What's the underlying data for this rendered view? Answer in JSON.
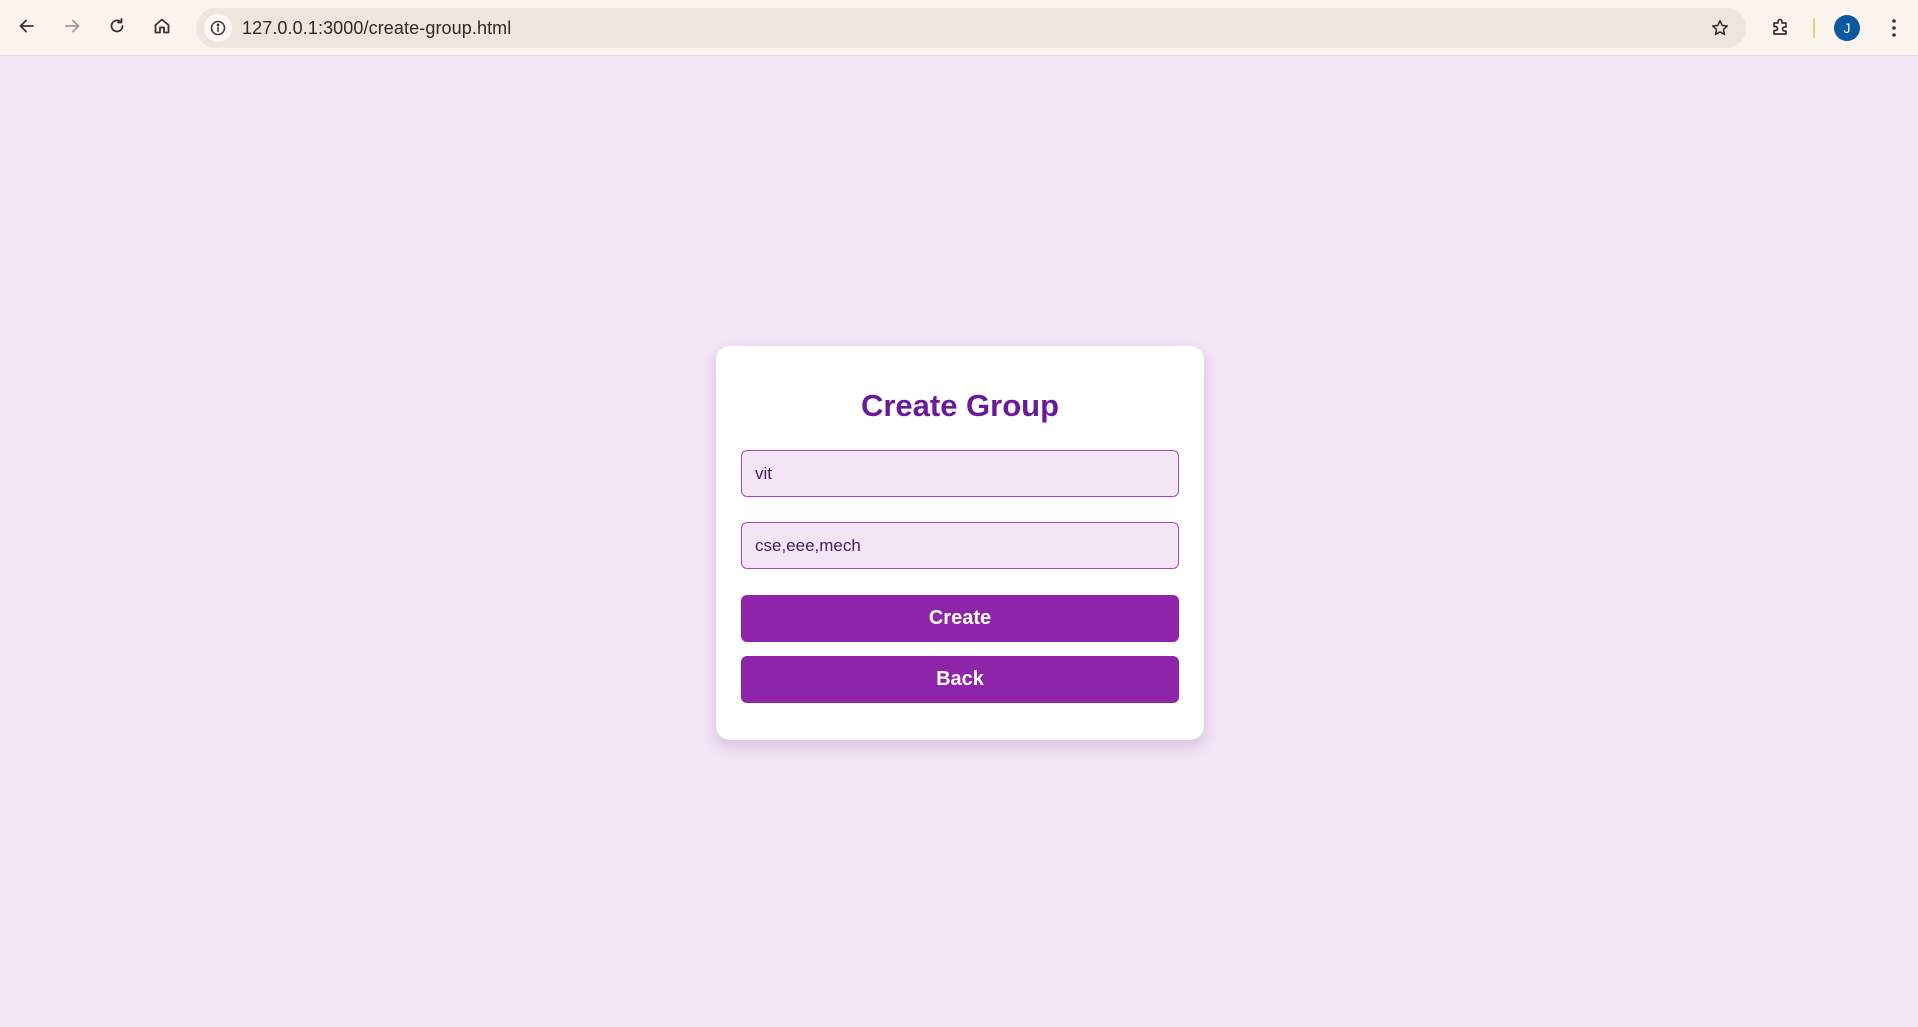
{
  "browser": {
    "url": "127.0.0.1:3000/create-group.html",
    "profile_initial": "J",
    "icons": {
      "back": "arrow-left-icon",
      "forward": "arrow-right-icon",
      "reload": "reload-icon",
      "home": "home-icon",
      "site_info": "info-icon",
      "bookmark": "star-icon",
      "extensions": "puzzle-icon",
      "menu": "kebab-menu-icon"
    },
    "colors": {
      "chrome_bg": "#fbf3ee",
      "omnibox_bg": "#efe5df",
      "avatar_bg": "#0b57a0"
    }
  },
  "page": {
    "title": "Create Group",
    "group_name_value": "vit",
    "members_value": "cse,eee,mech",
    "create_label": "Create",
    "back_label": "Back",
    "colors": {
      "background": "#f2e5f6",
      "card": "#ffffff",
      "title": "#6a1b9a",
      "input_bg": "#f3e5f5",
      "input_border": "#ab47bc",
      "button": "#8e24aa",
      "button_text": "#ffffff"
    }
  }
}
